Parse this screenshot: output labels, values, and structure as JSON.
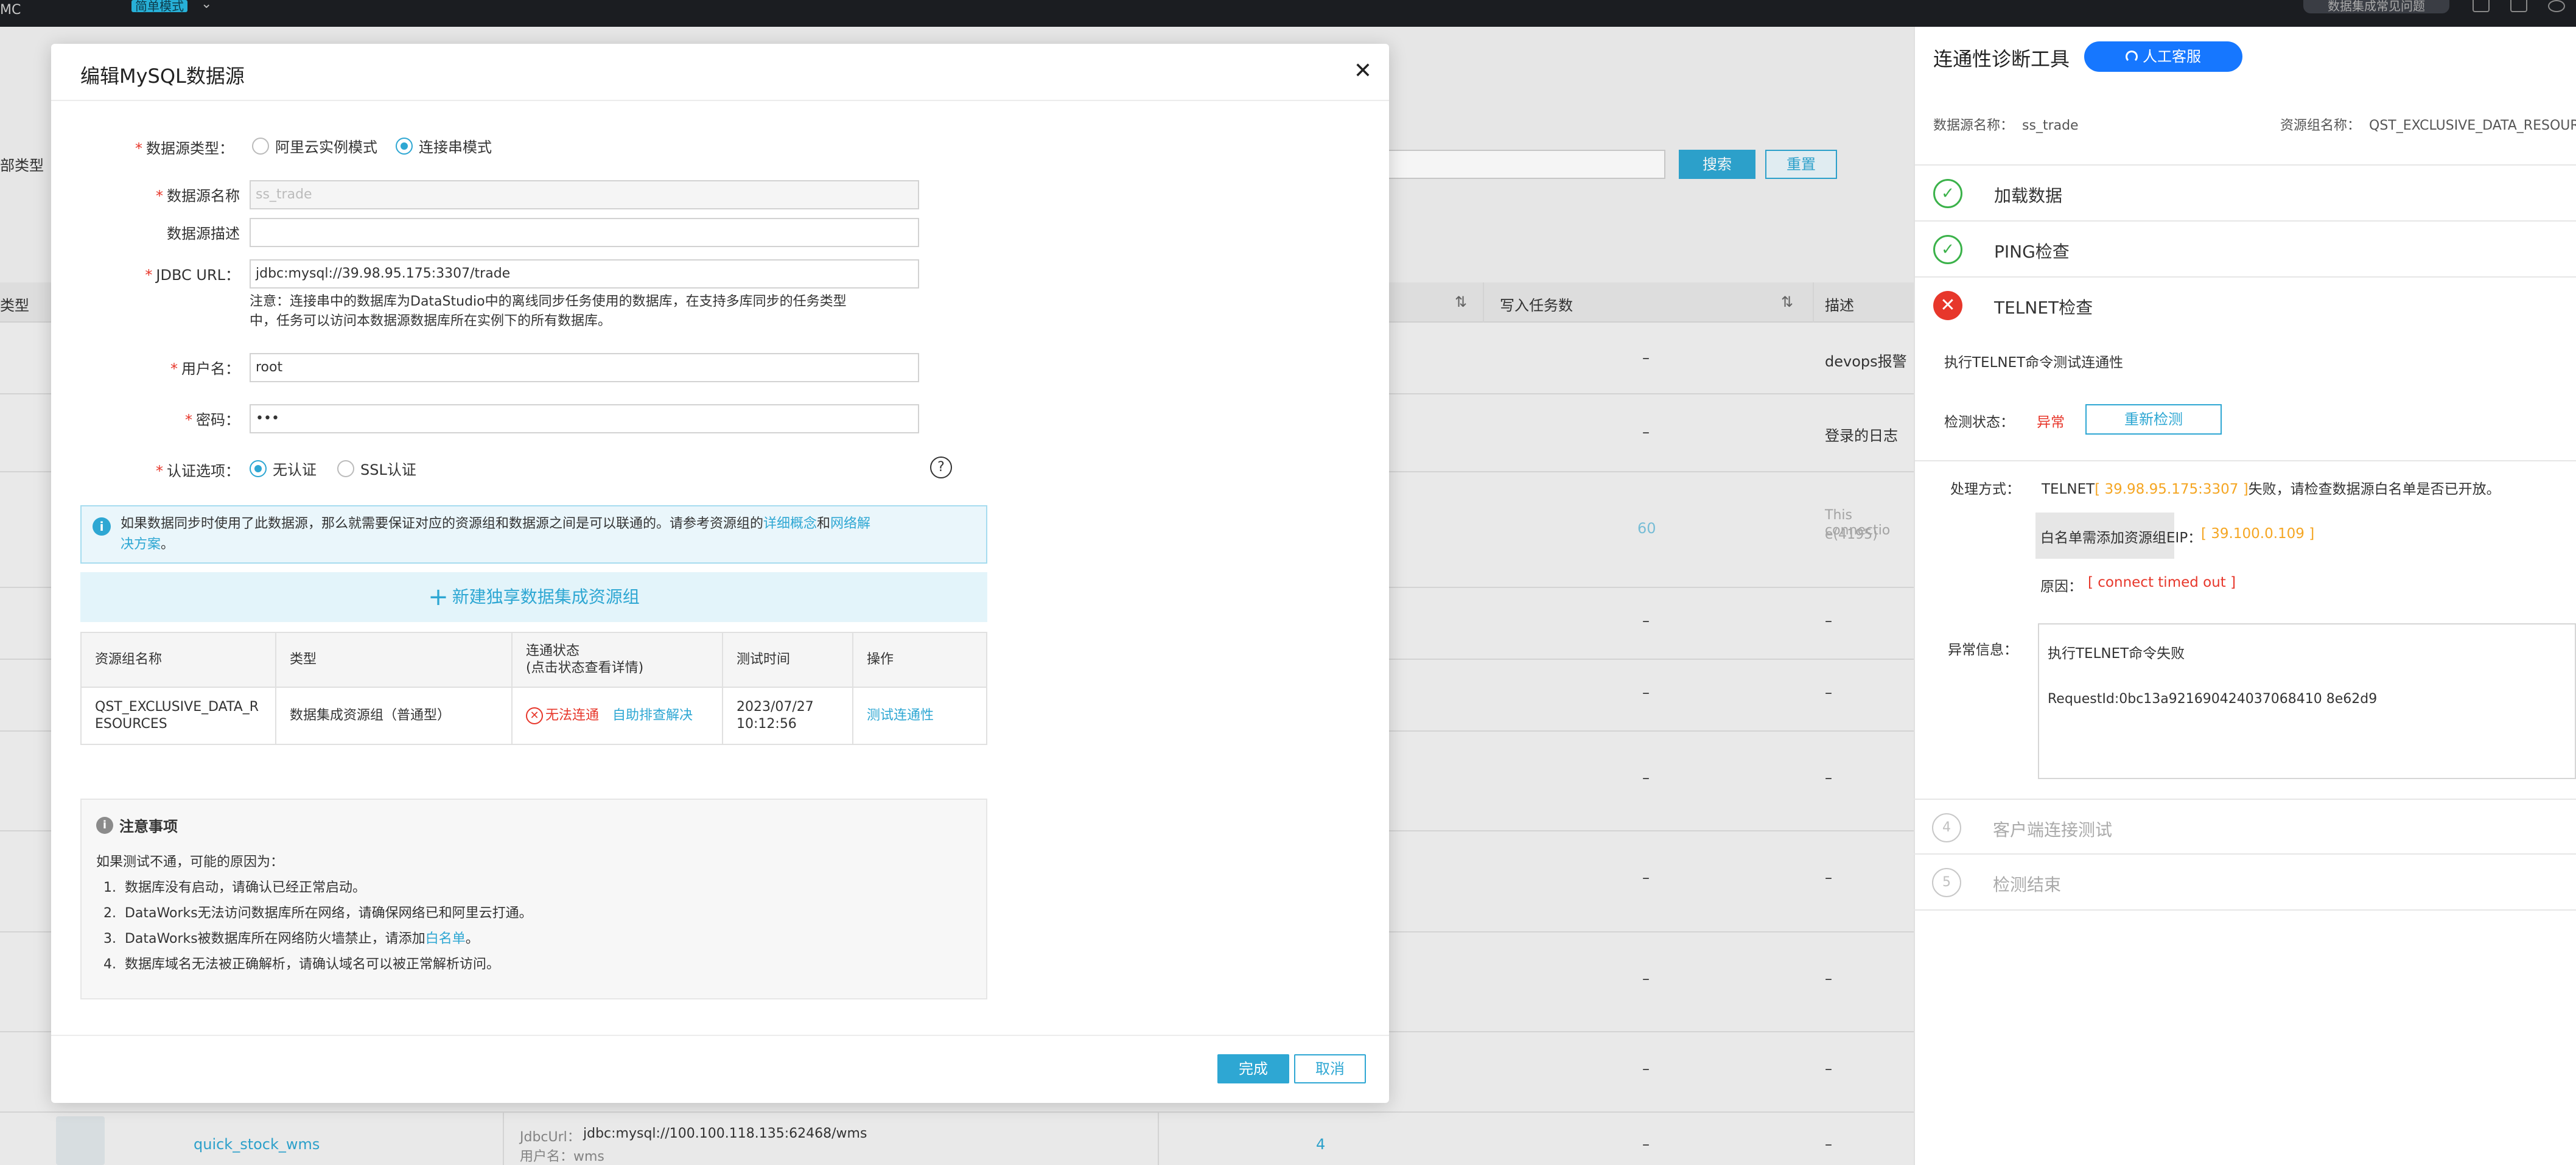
{
  "topbar": {
    "app": "MC",
    "mode": "简单模式",
    "help": "数据集成常见问题"
  },
  "background": {
    "filter_label": "部类型",
    "search": "搜索",
    "reset": "重置",
    "col_type": "类型",
    "col_write_tasks": "写入任务数",
    "col_desc": "描述",
    "rows": [
      {
        "dash": "–",
        "desc": "devops报警"
      },
      {
        "dash": "–",
        "desc": "登录的日志"
      },
      {
        "count": "60",
        "desc_line1": "This connectio",
        "desc_line2": "e(4195)"
      },
      {
        "dash": "–",
        "desc": "–"
      },
      {
        "dash": "–",
        "desc": "–"
      },
      {
        "dash": "–",
        "desc": "–"
      },
      {
        "dash": "–",
        "desc": "–"
      },
      {
        "dash": "–",
        "desc": "–"
      },
      {
        "dash": "–",
        "desc": "–"
      }
    ],
    "last_row": {
      "name": "quick_stock_wms",
      "jdbc_label": "JdbcUrl：",
      "jdbc_value": "jdbc:mysql://100.100.118.135:62468/wms",
      "user_partial": "用户名：wms",
      "count": "4",
      "desc": "–"
    }
  },
  "modal": {
    "title": "编辑MySQL数据源",
    "close_icon": "close-icon",
    "source_type_label": "数据源类型",
    "source_type_options": [
      "阿里云实例模式",
      "连接串模式"
    ],
    "source_type_selected": "连接串模式",
    "name_label": "数据源名称",
    "name_value": "ss_trade",
    "desc_label": "数据源描述",
    "desc_value": "",
    "jdbc_label": "JDBC URL",
    "jdbc_value": "jdbc:mysql://39.98.95.175:3307/trade",
    "jdbc_note_1": "注意：连接串中的数据库为DataStudio中的离线同步任务使用的数据库，在支持多库同步的任务类型",
    "jdbc_note_2": "中，任务可以访问本数据源数据库所在实例下的所有数据库。",
    "user_label": "用户名",
    "user_value": "root",
    "password_label": "密码",
    "password_value": "•••",
    "auth_label": "认证选项",
    "auth_options": [
      "无认证",
      "SSL认证"
    ],
    "auth_selected": "无认证",
    "info_text_1": "如果数据同步时使用了此数据源，那么就需要保证对应的资源组和数据源之间是可以联通的。请参考资源组的",
    "info_link_1": "详细概念",
    "info_and": "和",
    "info_link_2a": "网络解",
    "info_link_2b": "决方案",
    "info_end": "。",
    "add_group": "新建独享数据集成资源组",
    "table": {
      "headers": [
        "资源组名称",
        "类型",
        "连通状态",
        "测试时间",
        "操作"
      ],
      "status_sub": "(点击状态查看详情)",
      "row": {
        "name_1": "QST_EXCLUSIVE_DATA_R",
        "name_2": "ESOURCES",
        "type": "数据集成资源组（普通型）",
        "status": "无法连通",
        "self_help": "自助排查解决",
        "date": "2023/07/27",
        "time": "10:12:56",
        "action": "测试连通性"
      }
    },
    "notice": {
      "title": "注意事项",
      "intro": "如果测试不通，可能的原因为：",
      "items": [
        "数据库没有启动，请确认已经正常启动。",
        "DataWorks无法访问数据库所在网络，请确保网络已和阿里云打通。",
        "DataWorks被数据库所在网络防火墙禁止，请添加",
        "数据库域名无法被正确解析，请确认域名可以被正常解析访问。"
      ],
      "whitelist_link": "白名单",
      "period": "。"
    },
    "done": "完成",
    "cancel": "取消"
  },
  "panel": {
    "title": "连通性诊断工具",
    "support": "人工客服",
    "ds_name_label": "数据源名称：",
    "ds_name": "ss_trade",
    "rg_name_label": "资源组名称：",
    "rg_name": "QST_EXCLUSIVE_DATA_RESOUR",
    "steps": [
      {
        "label": "加载数据",
        "state": "ok"
      },
      {
        "label": "PING检查",
        "state": "ok"
      },
      {
        "label": "TELNET检查",
        "state": "fail"
      },
      {
        "label": "客户端连接测试",
        "state": "todo",
        "num": "4"
      },
      {
        "label": "检测结束",
        "state": "todo",
        "num": "5"
      }
    ],
    "telnet_desc": "执行TELNET命令测试连通性",
    "status_label": "检测状态：",
    "status_value": "异常",
    "recheck": "重新检测",
    "handle_label": "处理方式：",
    "handle_prefix": "TELNET",
    "handle_addr": "[ 39.98.95.175:3307 ]",
    "handle_suffix": "失败，请检查数据源白名单是否已开放。",
    "whitelist_label": "白名单需添加资源组EIP：",
    "whitelist_ip": "[ 39.100.0.109 ]",
    "reason_label": "原因：",
    "reason_value": "[ connect timed out ]",
    "exception_label": "异常信息：",
    "exception_line1": "执行TELNET命令失败",
    "exception_line2": "RequestId:0bc13a921690424037068410 8e62d9"
  },
  "colors": {
    "accent": "#2ea7d3",
    "error": "#e7372b",
    "success": "#3bb24a",
    "warning": "#f5a623",
    "support_button": "#1677ff"
  }
}
